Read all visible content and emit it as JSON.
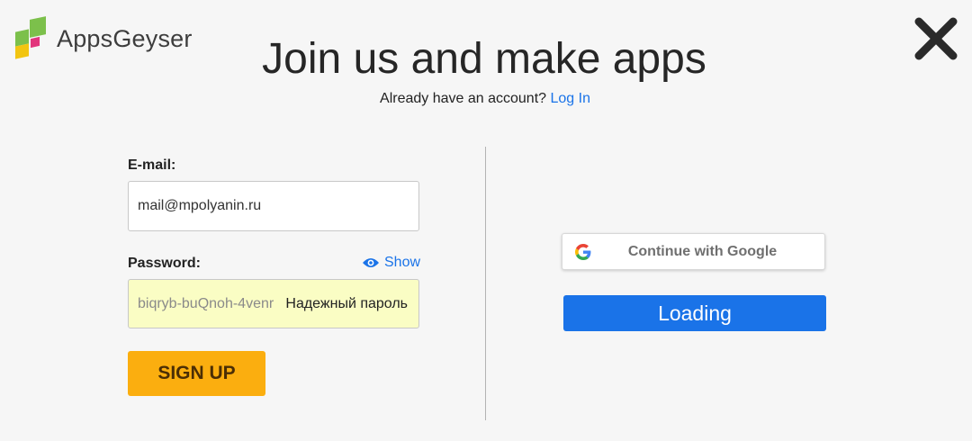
{
  "brand": {
    "name": "AppsGeyser"
  },
  "header": {
    "title": "Join us and make apps",
    "subtitle_prefix": "Already have an account?",
    "login_link": "Log In"
  },
  "form": {
    "email_label": "E-mail:",
    "email_value": "mail@mpolyanin.ru",
    "password_label": "Password:",
    "show_label": "Show",
    "password_value": "biqryb-buQnoh-4venr",
    "password_hint": "Надежный пароль",
    "signup_label": "SIGN UP"
  },
  "social": {
    "google_label": "Continue with Google",
    "loading_label": "Loading"
  },
  "colors": {
    "accent_blue": "#1a73e8",
    "signup_orange": "#fbae0f",
    "password_fill": "#fafdc4"
  },
  "icons": [
    "appsgeyser-logo-icon",
    "close-icon",
    "eye-icon",
    "google-icon"
  ]
}
